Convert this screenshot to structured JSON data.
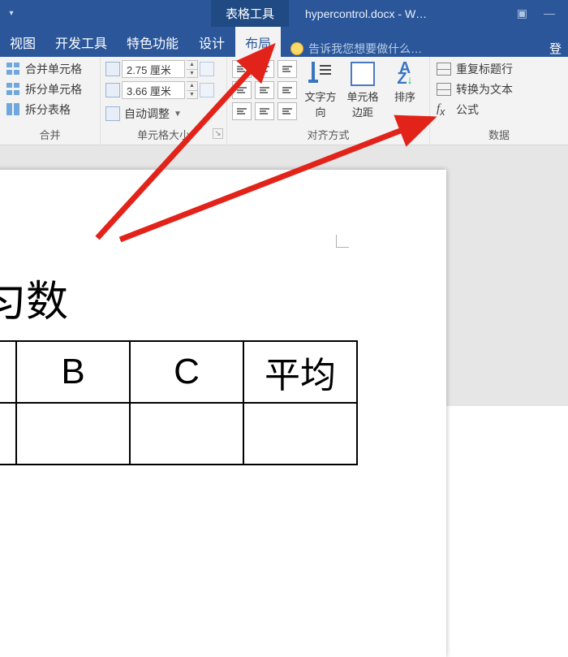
{
  "titlebar": {
    "context_tab": "表格工具",
    "doc_title": "hypercontrol.docx - W…"
  },
  "menubar": {
    "tabs": [
      "视图",
      "开发工具",
      "特色功能",
      "设计",
      "布局"
    ],
    "tell_me": "告诉我您想要做什么…",
    "login": "登"
  },
  "ribbon": {
    "merge": {
      "merge_cells": "合并单元格",
      "split_cells": "拆分单元格",
      "split_table": "拆分表格",
      "label": "合并"
    },
    "size": {
      "height": "2.75 厘米",
      "width": "3.66 厘米",
      "autofit": "自动调整",
      "label": "单元格大小"
    },
    "align": {
      "text_dir": "文字方向",
      "margins": "单元格边距",
      "sort": "排序",
      "label": "对齐方式"
    },
    "data": {
      "repeat_header": "重复标题行",
      "to_text": "转换为文本",
      "formula": "公式",
      "label": "数据"
    }
  },
  "document": {
    "heading_fragment": "匀数",
    "table": {
      "headers": [
        "",
        "B",
        "C",
        "平均"
      ]
    }
  }
}
